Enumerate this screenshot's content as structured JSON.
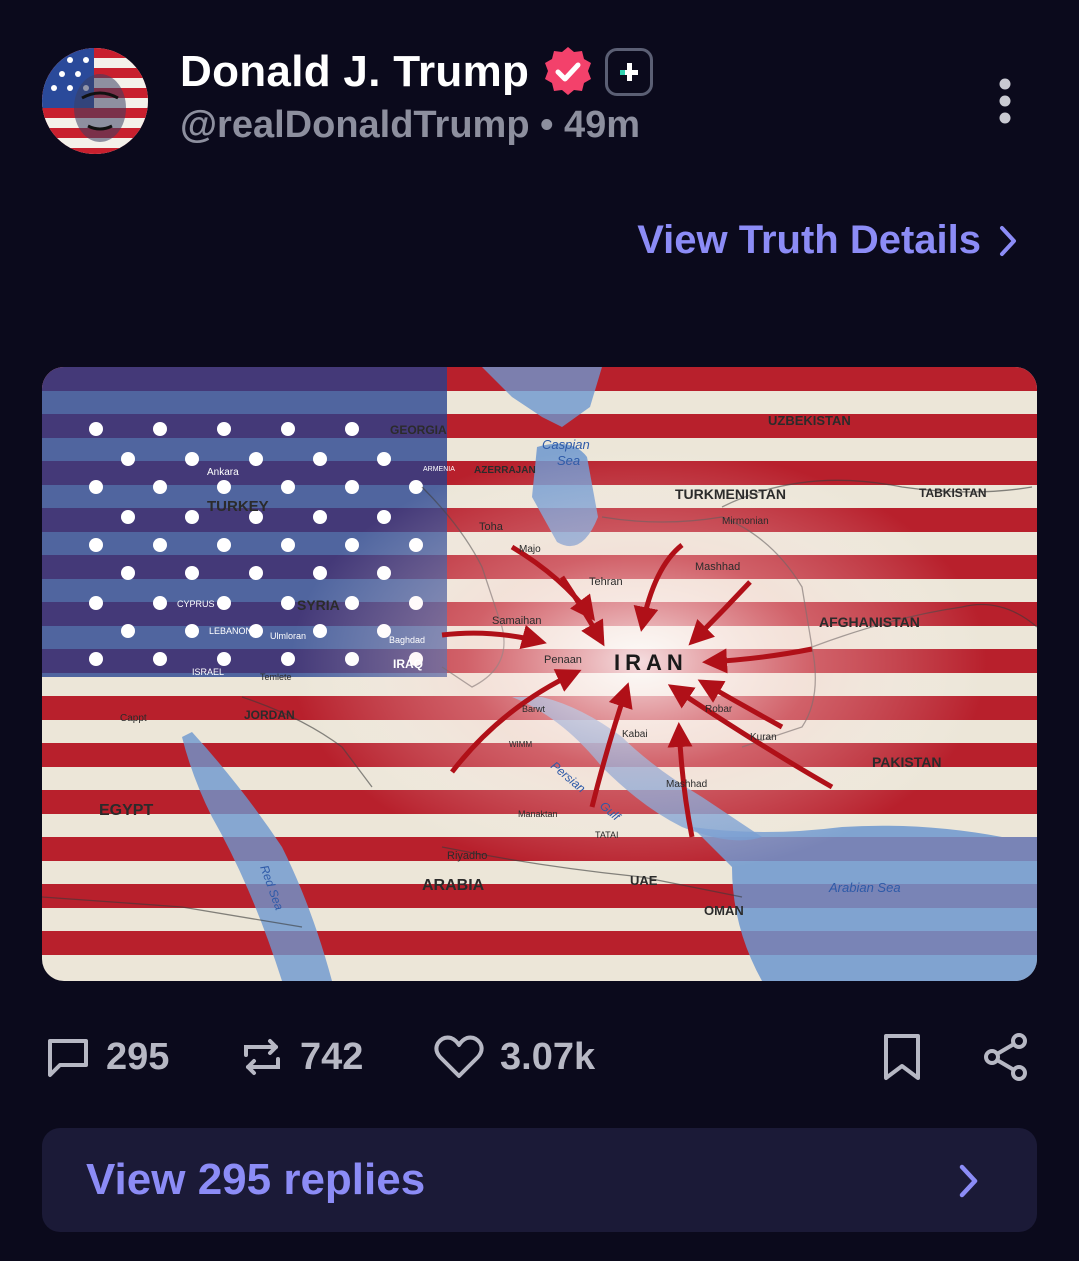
{
  "post": {
    "author_name": "Donald J. Trump",
    "handle": "@realDonaldTrump",
    "separator": "•",
    "time_ago": "49m",
    "view_details_label": "View Truth Details",
    "icons": {
      "verified": "verified-badge-icon",
      "plus": "plus-icon",
      "more": "more-vertical-icon",
      "chevron": "chevron-right-icon"
    }
  },
  "media": {
    "map_labels": {
      "turkey": "TURKEY",
      "ankara": "Ankara",
      "georgia": "GEORGIA",
      "azerbaijan": "AZERRAJAN",
      "armenia": "ARMENIA",
      "caspian": "Caspian",
      "sea": "Sea",
      "uzbekistan": "UZBEKISTAN",
      "turkmenistan": "TURKMENISTAN",
      "mirmonian": "Mirmonian",
      "tabkistan": "TABKISTAN",
      "toha": "Toha",
      "majo": "Majo",
      "tehran": "Tehran",
      "mashhad": "Mashhad",
      "syria": "SYRIA",
      "cyprus": "CYPRUS",
      "lebanon": "LEBANON",
      "ulmloran": "Ulmloran",
      "samaihan": "Samaihan",
      "afghanistan": "AFGHANISTAN",
      "baghdad": "Baghdad",
      "iraq": "IRAQ",
      "penaan": "Penaan",
      "iran": "IRAN",
      "israel": "ISRAEL",
      "temlete": "Temlete",
      "jordan": "JORDAN",
      "cappt": "Cappt",
      "barwt": "Barwt",
      "robar": "Robar",
      "kabai": "Kabai",
      "kuran": "Kuran",
      "wimm": "WIMM",
      "persian": "Persian",
      "gulf": "Gulf",
      "pakistan": "PAKISTAN",
      "mashhad2": "Mashhad",
      "egypt": "EGYPT",
      "manaktan": "Manaktan",
      "tatai": "TATAI",
      "riyadh": "Riyadho",
      "uae": "UAE",
      "arabia": "ARABIA",
      "red_sea": "Red Sea",
      "arabian_sea": "Arabian Sea",
      "oman": "OMAN"
    }
  },
  "actions": {
    "replies_count": "295",
    "reposts_count": "742",
    "likes_count": "3.07k",
    "icons": [
      "reply-icon",
      "repost-icon",
      "like-icon",
      "bookmark-icon",
      "share-icon"
    ]
  },
  "replies_button": {
    "label": "View 295 replies"
  },
  "colors": {
    "background": "#0b0a1c",
    "accent": "#8c8cf6",
    "muted": "#8d8f9e",
    "verified_pink": "#f3416b",
    "button_bg": "#1b1a37"
  }
}
